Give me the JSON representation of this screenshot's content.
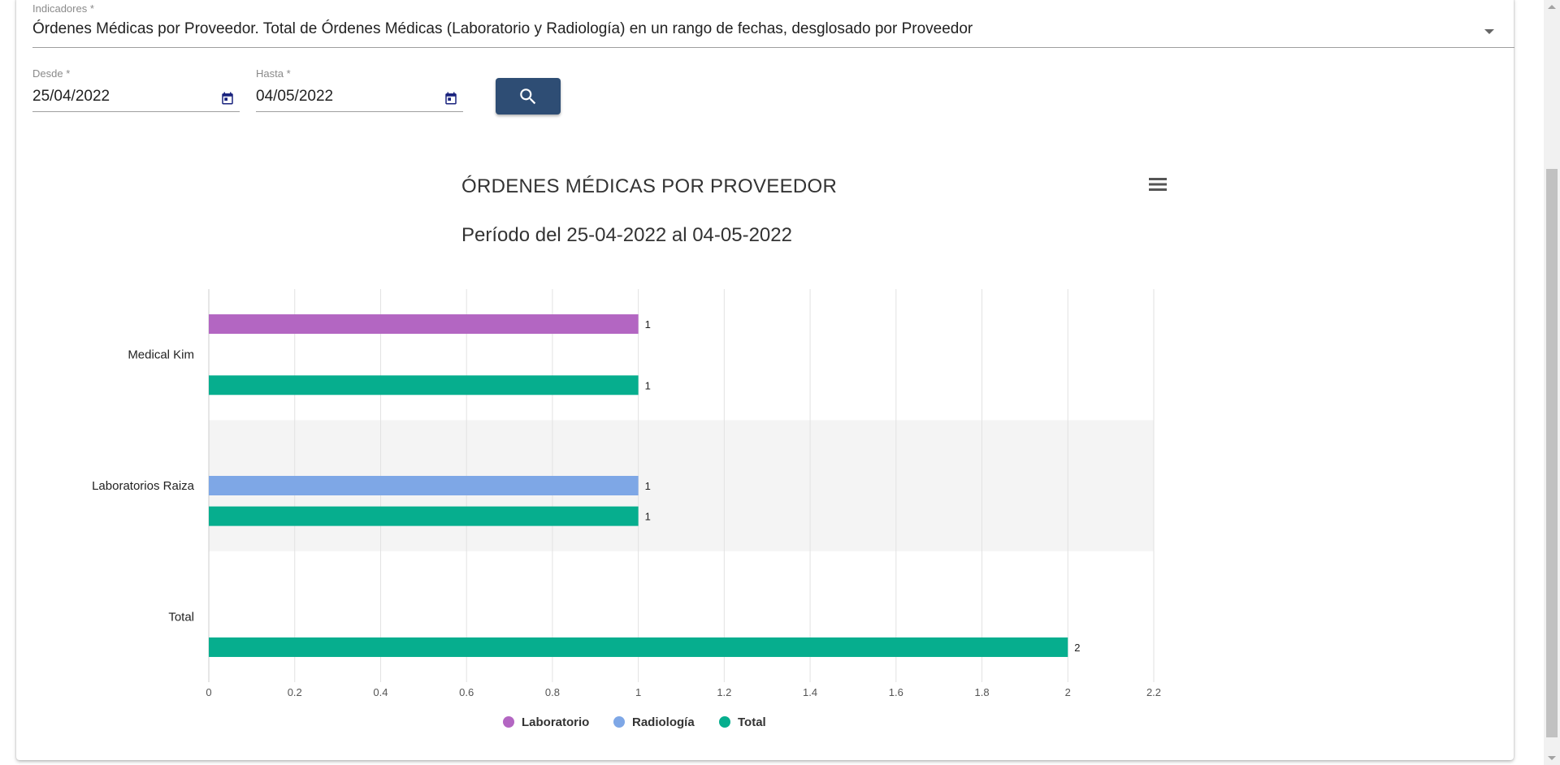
{
  "form": {
    "indicator_label": "Indicadores *",
    "indicator_value": "Órdenes Médicas por Proveedor. Total de Órdenes Médicas (Laboratorio y Radiología) en un rango de fechas, desglosado por Proveedor",
    "from_label": "Desde *",
    "from_value": "25/04/2022",
    "to_label": "Hasta *",
    "to_value": "04/05/2022"
  },
  "icons": {
    "search": "search-icon",
    "calendar": "calendar-icon",
    "menu": "hamburger-menu-icon",
    "dropdown": "dropdown-arrow-icon"
  },
  "colors": {
    "accent": "#2e4d74",
    "calendar_icon": "#1a237e",
    "laboratorio": "#b366c2",
    "radiologia": "#7ea7e6",
    "total": "#06ae8e"
  },
  "chart_data": {
    "type": "bar",
    "orientation": "horizontal",
    "title": "ÓRDENES MÉDICAS POR PROVEEDOR",
    "subtitle": "Período del 25-04-2022 al 04-05-2022",
    "categories": [
      "Medical Kim",
      "Laboratorios Raiza",
      "Total"
    ],
    "series": [
      {
        "name": "Laboratorio",
        "values": [
          1,
          null,
          null
        ]
      },
      {
        "name": "Radiología",
        "values": [
          null,
          1,
          null
        ]
      },
      {
        "name": "Total",
        "values": [
          1,
          1,
          2
        ]
      }
    ],
    "xlim": [
      0,
      2.2
    ],
    "xticks": [
      "0",
      "0.2",
      "0.4",
      "0.6",
      "0.8",
      "1",
      "1.2",
      "1.4",
      "1.6",
      "1.8",
      "2",
      "2.2"
    ],
    "grid": true,
    "legend": "bottom-center",
    "data_labels": true
  }
}
